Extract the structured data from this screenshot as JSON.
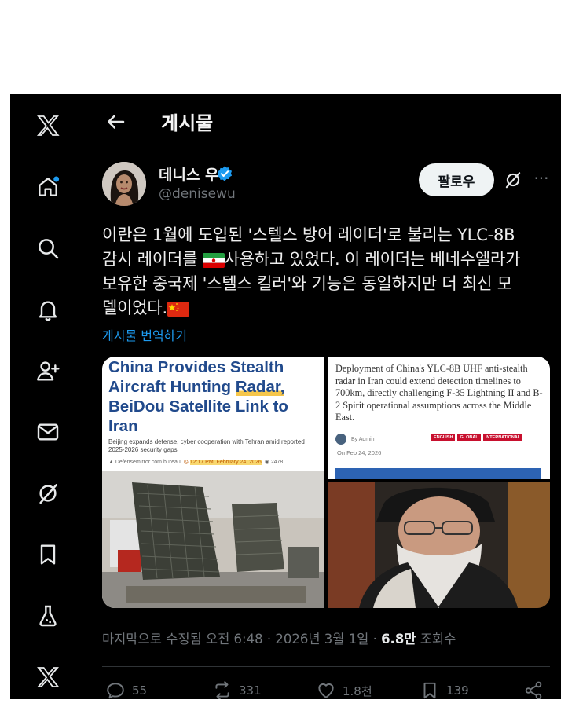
{
  "page": {
    "title": "게시물"
  },
  "nav": [
    {
      "name": "x-logo-icon"
    },
    {
      "name": "home-icon"
    },
    {
      "name": "search-icon"
    },
    {
      "name": "notifications-icon"
    },
    {
      "name": "follow-icon"
    },
    {
      "name": "messages-icon"
    },
    {
      "name": "grok-icon"
    },
    {
      "name": "bookmarks-icon"
    },
    {
      "name": "labs-icon"
    },
    {
      "name": "premium-x-icon"
    }
  ],
  "author": {
    "name": "데니스 우",
    "handle": "@denisewu",
    "follow_label": "팔로우",
    "more": "···"
  },
  "post": {
    "line1": "이란은 1월에 도입된 '스텔스 방어 레이더'로 불리는 YLC-8B",
    "line2a": "감시 레이더를 ",
    "line2b": "사용하고 있었다. 이 레이더는 베네수엘라가",
    "line3": "보유한 중국제 '스텔스 킬러'와 기능은 동일하지만 더 최신 모",
    "line4": "델이었다.",
    "translate": "게시물 번역하기"
  },
  "media": {
    "card1": {
      "headline_a": "China Provides Stealth",
      "headline_b": "Aircraft Hunting ",
      "headline_radar": "Radar,",
      "headline_c": "BeiDou Satellite Link to",
      "headline_d": "Iran",
      "sub": "Beijing expands defense, cyber cooperation with Tehran amid reported 2025-2026 security gaps",
      "source": "Defensemirror.com bureau",
      "time": "12:17 PM, February 24, 2026",
      "views": "2478"
    },
    "card2": {
      "text": "Deployment of China's YLC-8B UHF anti-stealth radar in Iran could extend detection timelines to 700km, directly challenging F-35 Lightning II and B-2 Spirit operational assumptions across the Middle East.",
      "author": "By Admin",
      "date": "On Feb 24, 2026",
      "tags": [
        "ENGLISH",
        "GLOBAL",
        "INTERNATIONAL"
      ]
    }
  },
  "meta": {
    "edited": "마지막으로 수정됨 오전 6:48 · 2026년 3월 1일 · ",
    "views_count": "6.8만",
    "views_label": " 조회수"
  },
  "actions": {
    "replies": "55",
    "reposts": "331",
    "likes": "1.8천",
    "bookmarks": "139"
  },
  "colors": {
    "accent": "#1d9bf0",
    "background": "#000000",
    "muted": "#71767b"
  }
}
